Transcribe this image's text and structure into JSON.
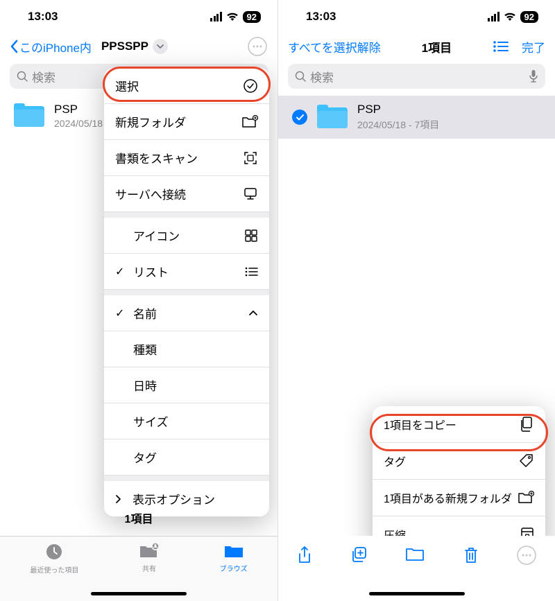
{
  "status": {
    "time": "13:03",
    "battery": "92"
  },
  "left": {
    "back_label": "このiPhone内",
    "title": "PPSSPP",
    "search_placeholder": "検索",
    "folder": {
      "name": "PSP",
      "date": "2024/05/18"
    },
    "menu": {
      "select": "選択",
      "new_folder": "新規フォルダ",
      "scan_docs": "書類をスキャン",
      "connect_server": "サーバへ接続",
      "icons": "アイコン",
      "list": "リスト",
      "name": "名前",
      "kind": "種類",
      "date": "日時",
      "size": "サイズ",
      "tag": "タグ",
      "display_options": "表示オプション"
    },
    "count": "1項目",
    "tabs": {
      "recents": "最近使った項目",
      "shared": "共有",
      "browse": "ブラウズ"
    }
  },
  "right": {
    "deselect_all": "すべてを選択解除",
    "selection_count": "1項目",
    "done": "完了",
    "search_placeholder": "検索",
    "folder": {
      "name": "PSP",
      "meta": "2024/05/18 - 7項目"
    },
    "actions": {
      "copy": "1項目をコピー",
      "tag": "タグ",
      "new_folder": "1項目がある新規フォルダ",
      "compress": "圧縮"
    }
  }
}
